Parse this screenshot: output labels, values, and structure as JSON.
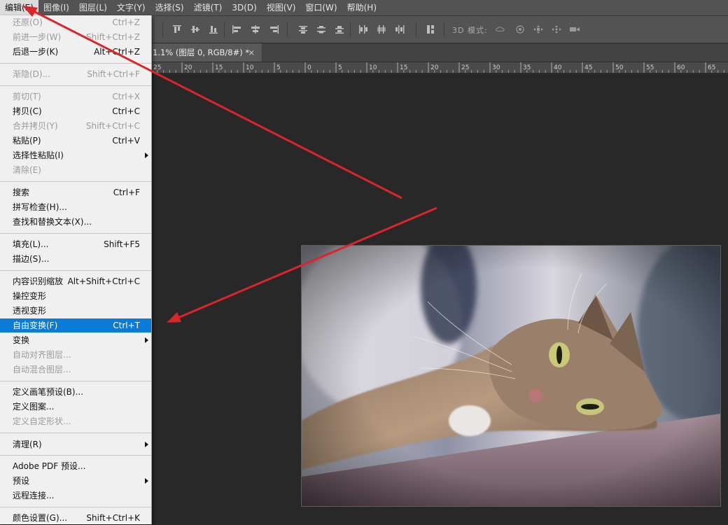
{
  "menubar": {
    "items": [
      {
        "label": "编辑(E)",
        "active": true
      },
      {
        "label": "图像(I)"
      },
      {
        "label": "图层(L)"
      },
      {
        "label": "文字(Y)"
      },
      {
        "label": "选择(S)"
      },
      {
        "label": "滤镜(T)"
      },
      {
        "label": "3D(D)"
      },
      {
        "label": "视图(V)"
      },
      {
        "label": "窗口(W)"
      },
      {
        "label": "帮助(H)"
      }
    ]
  },
  "optionsbar": {
    "mode_label": "3D 模式:"
  },
  "document": {
    "tab_title": "1.1% (图层 0, RGB/8#) *",
    "close_glyph": "×"
  },
  "ruler": {
    "labels": [
      "25",
      "20",
      "15",
      "10",
      "5",
      "0",
      "5",
      "10",
      "15",
      "20",
      "25",
      "30",
      "35",
      "40",
      "45",
      "50",
      "55",
      "60",
      "65"
    ]
  },
  "edit_menu": {
    "items": [
      {
        "label": "还原(O)",
        "shortcut": "Ctrl+Z",
        "disabled": true
      },
      {
        "label": "前进一步(W)",
        "shortcut": "Shift+Ctrl+Z",
        "disabled": true
      },
      {
        "label": "后退一步(K)",
        "shortcut": "Alt+Ctrl+Z"
      },
      {
        "label": "渐隐(D)...",
        "shortcut": "Shift+Ctrl+F",
        "disabled": true
      },
      {
        "label": "剪切(T)",
        "shortcut": "Ctrl+X",
        "disabled": true
      },
      {
        "label": "拷贝(C)",
        "shortcut": "Ctrl+C"
      },
      {
        "label": "合并拷贝(Y)",
        "shortcut": "Shift+Ctrl+C",
        "disabled": true
      },
      {
        "label": "粘贴(P)",
        "shortcut": "Ctrl+V"
      },
      {
        "label": "选择性粘贴(I)",
        "submenu": true
      },
      {
        "label": "清除(E)",
        "disabled": true
      },
      {
        "label": "搜索",
        "shortcut": "Ctrl+F"
      },
      {
        "label": "拼写检查(H)..."
      },
      {
        "label": "查找和替换文本(X)..."
      },
      {
        "label": "填充(L)...",
        "shortcut": "Shift+F5"
      },
      {
        "label": "描边(S)..."
      },
      {
        "label": "内容识别缩放",
        "shortcut": "Alt+Shift+Ctrl+C"
      },
      {
        "label": "操控变形"
      },
      {
        "label": "透视变形"
      },
      {
        "label": "自由变换(F)",
        "shortcut": "Ctrl+T",
        "highlighted": true
      },
      {
        "label": "变换",
        "submenu": true
      },
      {
        "label": "自动对齐图层...",
        "disabled": true
      },
      {
        "label": "自动混合图层...",
        "disabled": true
      },
      {
        "label": "定义画笔预设(B)..."
      },
      {
        "label": "定义图案..."
      },
      {
        "label": "定义自定形状...",
        "disabled": true
      },
      {
        "label": "清理(R)",
        "submenu": true
      },
      {
        "label": "Adobe PDF 预设..."
      },
      {
        "label": "预设",
        "submenu": true
      },
      {
        "label": "远程连接..."
      },
      {
        "label": "颜色设置(G)...",
        "shortcut": "Shift+Ctrl+K"
      }
    ]
  },
  "colors": {
    "highlight": "#0a7bd6",
    "annotation_arrow": "#d9252b"
  }
}
